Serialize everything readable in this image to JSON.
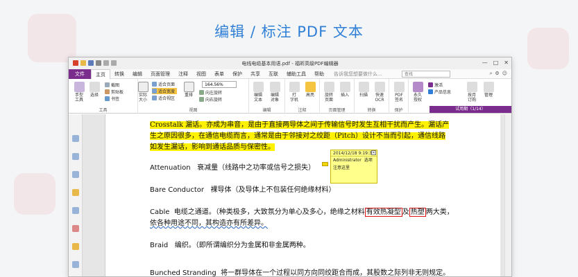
{
  "headline": "编辑 / 标注 PDF 文本",
  "window": {
    "title": "电线电缆基本用语.pdf - 福昕高级PDF编辑器",
    "controls": [
      "—",
      "□",
      "✕"
    ]
  },
  "menu": {
    "file": "文件",
    "tabs": [
      "主页",
      "转换",
      "编辑",
      "页面管理",
      "注释",
      "视图",
      "表单",
      "保护",
      "共享",
      "互联",
      "辅助工具",
      "帮助"
    ],
    "help_hint": "告诉我您想要做什么...",
    "search_placeholder": "查找"
  },
  "ribbon": {
    "groups": {
      "tools": "工具",
      "view": "视图",
      "edit": "编辑",
      "comment": "注释",
      "page_mgmt": "页面管理",
      "convert": "转换",
      "protect": "保护"
    },
    "hand": "手型\n工具",
    "select": "选择",
    "snapshot": "截图",
    "clipboard": "剪贴板",
    "bookmark": "书签",
    "actual_size": "实际\n大小",
    "fit_page": "适合页面",
    "fit_width": "适合宽度",
    "fit_visible": "适合视区",
    "reflow": "重排",
    "zoom": "164.56%",
    "rotate_left": "向左旋转",
    "rotate_right": "向右旋转",
    "edit_text": "编辑\n文本",
    "edit_object": "编辑\n对象",
    "typewriter": "打\n字机",
    "highlight": "高亮",
    "rotate_page": "旋转\n页面",
    "insert": "插入",
    "scan": "扫描",
    "quick_ocr": "快速\nOCR",
    "pdf_sign": "PDF\n签名",
    "permanent_auth": "永久\n授权",
    "activate": "激活",
    "product_info": "产品信息",
    "subscribe": "按月\n订购",
    "manage": "管理",
    "trial": "试用期（1/14）"
  },
  "document": {
    "lines": [
      {
        "text": "Crosstalk 漏话。亦成为串音，是由于直接两导体之间于传输信号时发生互相干扰而产生。漏话产",
        "style": "yellow"
      },
      {
        "text": "生之原因很多，在通信电缆而言，通常是由于邻接对之绞距（Pitch）设计不当而引起，通信线路",
        "style": "yellow"
      },
      {
        "text": "如发生漏话，影响到通话品质与保密性。",
        "style": "yellow"
      },
      {
        "term": "Attenuation",
        "text": "衰减量（线路中之功率或信号之损失）"
      },
      {
        "term": "Bare Conductor",
        "text": "裸导体（及导体上不包装任何绝缘材料）"
      },
      {
        "term": "Cable",
        "pre": "电缆之通道。（种类极多，大致氛分为单心及多心，绝缘之材料",
        "box1": "有效热凝型",
        "mid": "及",
        "box2": "热塑",
        "post": "两大类，"
      },
      {
        "text": "依各种用途不同，其构造亦有所差异。",
        "style": "wavy"
      },
      {
        "term": "Braid",
        "text": "编织。（即所谓编织分为金属和非金属两种。"
      },
      {
        "term": "Bunched  Stranding",
        "text": "将一群导体在一个过程以同方向同绞距合而成，其股数之际列非无则规定。",
        "style": "wavy"
      }
    ]
  },
  "note": {
    "date": "2014/12/18 9:19:39",
    "author": "Administrator",
    "options": "选项",
    "content": "注意这里"
  },
  "colors": {
    "brand": "#7b2d8e",
    "headline": "#2f7fd6",
    "highlight": "#fff200",
    "note": "#ffff8c"
  }
}
